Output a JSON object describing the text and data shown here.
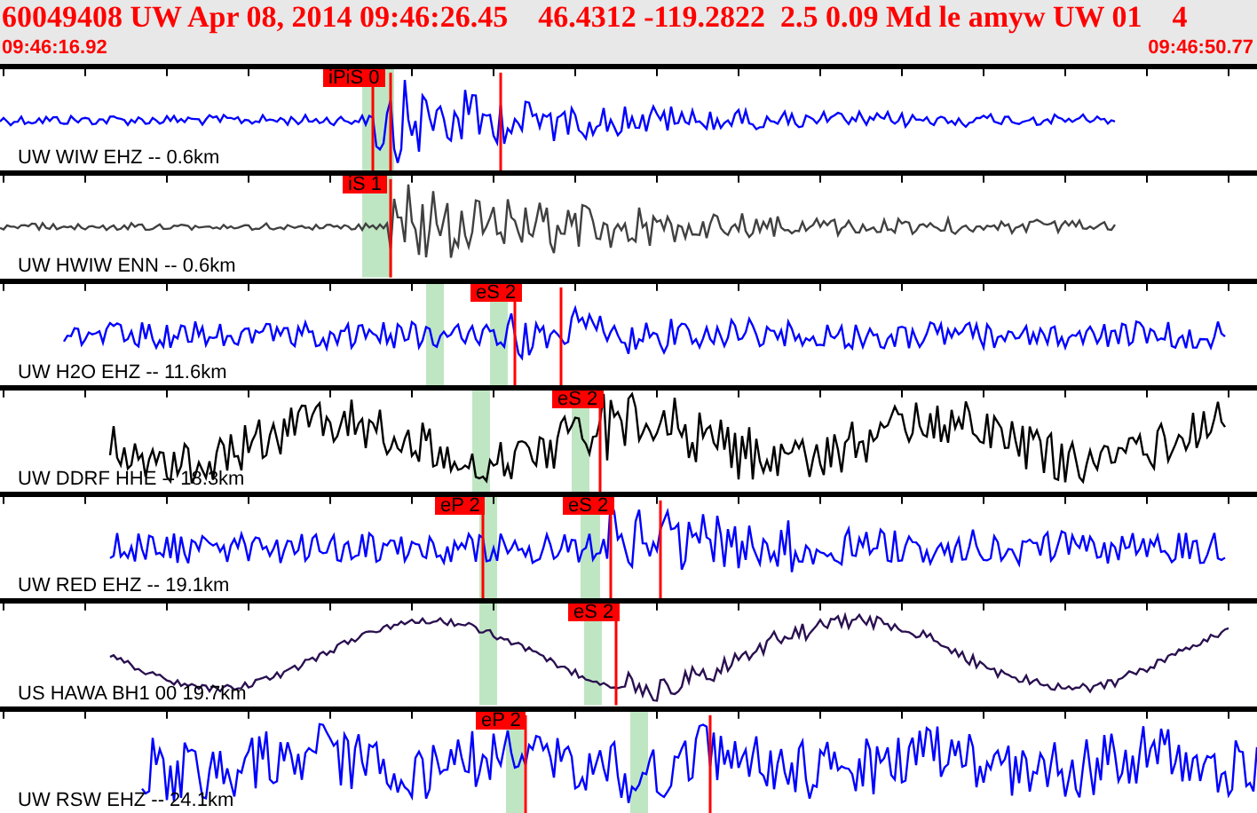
{
  "header": {
    "title": "60049408 UW Apr 08, 2014 09:46:26.45    46.4312 -119.2822  2.5 0.09 Md le amyw UW 01    4",
    "start_time": "09:46:16.92",
    "end_time": "09:46:50.77"
  },
  "traces": [
    {
      "station": "UW WIW EHZ -- 0.6km",
      "color": "#0000ff",
      "picks": [
        {
          "label": "iPiS 0"
        }
      ]
    },
    {
      "station": "UW HWIW ENN -- 0.6km",
      "color": "#404040",
      "picks": [
        {
          "label": "iS 1"
        }
      ]
    },
    {
      "station": "UW H2O EHZ -- 11.6km",
      "color": "#0000ff",
      "picks": [
        {
          "label": "eS 2"
        }
      ]
    },
    {
      "station": "UW DDRF HHE -- 18.3km",
      "color": "#000000",
      "picks": [
        {
          "label": "eS 2"
        }
      ]
    },
    {
      "station": "UW RED EHZ -- 19.1km",
      "color": "#0000ff",
      "picks": [
        {
          "label": "eP 2"
        },
        {
          "label": "eS 2"
        }
      ]
    },
    {
      "station": "US HAWA BH1 00 19.7km",
      "color": "#2a1050",
      "picks": [
        {
          "label": "eS 2"
        }
      ]
    },
    {
      "station": "UW RSW EHZ -- 24.1km",
      "color": "#0000ff",
      "picks": [
        {
          "label": "eP 2"
        }
      ]
    }
  ]
}
